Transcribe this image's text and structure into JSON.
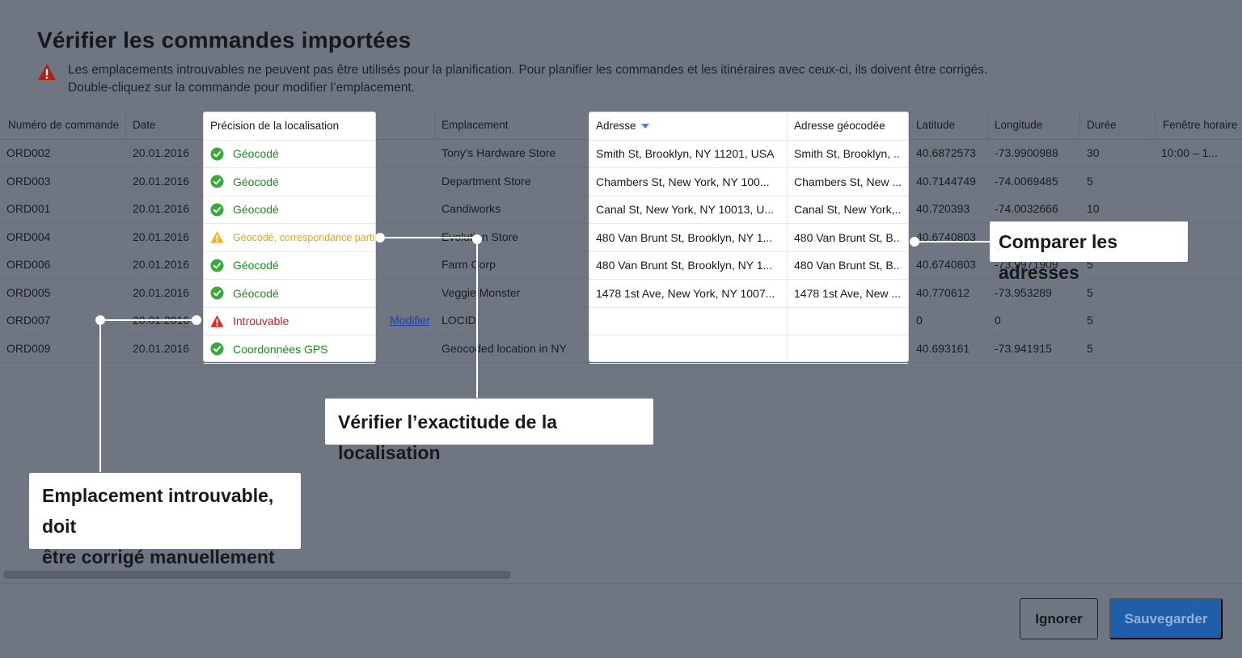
{
  "dialog": {
    "title": "Vérifier les commandes importées",
    "warning_line1": "Les emplacements introuvables ne peuvent pas être utilisés pour la planification. Pour planifier les commandes et les itinéraires avec ceux-ci, ils doivent être corrigés.",
    "warning_line2": "Double-cliquez sur la commande pour modifier l’emplacement.",
    "warning_icon": "warning-triangle-icon"
  },
  "table": {
    "headers": {
      "order": "Numéro de commande",
      "date": "Date",
      "precision": "Précision de la localisation",
      "location": "Emplacement",
      "address": "Adresse",
      "geocoded": "Adresse géocodée",
      "latitude": "Latitude",
      "longitude": "Longitude",
      "duration": "Durée",
      "window": "Fenêtre horaire"
    },
    "sort": {
      "column": "address",
      "direction": "descending"
    },
    "rows": [
      {
        "order": "ORD002",
        "date": "20.01.2016",
        "status": "Géocodé",
        "status_type": "ok",
        "edit": "",
        "location": "Tony's Hardware Store",
        "address": "Smith St, Brooklyn, NY 11201, USA",
        "geocoded": "Smith St, Brooklyn, ...",
        "lat": "40.6872573",
        "lng": "-73.9900988",
        "duration": "30",
        "window": "10:00 – 1..."
      },
      {
        "order": "ORD003",
        "date": "20.01.2016",
        "status": "Géocodé",
        "status_type": "ok",
        "edit": "",
        "location": "Department Store",
        "address": "Chambers St, New York, NY 100...",
        "geocoded": "Chambers St, New ...",
        "lat": "40.7144749",
        "lng": "-74.0069485",
        "duration": "5",
        "window": ""
      },
      {
        "order": "ORD001",
        "date": "20.01.2016",
        "status": "Géocodé",
        "status_type": "ok",
        "edit": "",
        "location": "Candiworks",
        "address": "Canal St, New York, NY 10013, U...",
        "geocoded": "Canal St, New York,...",
        "lat": "40.720393",
        "lng": "-74.0032666",
        "duration": "10",
        "window": ""
      },
      {
        "order": "ORD004",
        "date": "20.01.2016",
        "status": "Géocodé, correspondance partielle",
        "status_type": "partial",
        "edit": "",
        "location": "Evolution Store",
        "address": "480 Van Brunt St, Brooklyn, NY 1...",
        "geocoded": "480 Van Brunt St, B...",
        "lat": "40.6740803",
        "lng": "",
        "duration": "",
        "window": ""
      },
      {
        "order": "ORD006",
        "date": "20.01.2016",
        "status": "Géocodé",
        "status_type": "ok",
        "edit": "",
        "location": "Farm Corp",
        "address": "480 Van Brunt St, Brooklyn, NY 1...",
        "geocoded": "480 Van Brunt St, B...",
        "lat": "40.6740803",
        "lng": "-73.9971909",
        "duration": "5",
        "window": ""
      },
      {
        "order": "ORD005",
        "date": "20.01.2016",
        "status": "Géocodé",
        "status_type": "ok",
        "edit": "",
        "location": "Veggie Monster",
        "address": "1478 1st Ave, New York, NY 1007...",
        "geocoded": "1478 1st Ave, New ...",
        "lat": "40.770612",
        "lng": "-73.953289",
        "duration": "5",
        "window": ""
      },
      {
        "order": "ORD007",
        "date": "20.01.2016",
        "status": "Introuvable",
        "status_type": "error",
        "edit": "Modifier",
        "location": "LOCID",
        "address": "",
        "geocoded": "",
        "lat": "0",
        "lng": "0",
        "duration": "5",
        "window": ""
      },
      {
        "order": "ORD009",
        "date": "20.01.2016",
        "status": "Coordonnées GPS",
        "status_type": "ok",
        "edit": "",
        "location": "Geocoded location in NY",
        "address": "",
        "geocoded": "",
        "lat": "40.693161",
        "lng": "-73.941915",
        "duration": "5",
        "window": ""
      }
    ]
  },
  "callouts": {
    "compare": "Comparer les adresses",
    "verify": "Vérifier l’exactitude de la localisation",
    "notfound_line1": "Emplacement introuvable, doit",
    "notfound_line2": "être corrigé manuellement"
  },
  "footer": {
    "ignore_label": "Ignorer",
    "save_label": "Sauvegarder"
  },
  "colors": {
    "ok": "#1e8a1e",
    "partial": "#e8a312",
    "error": "#d21f1f",
    "primary_button": "#1f5ea8",
    "overlay": "#6f7681"
  }
}
